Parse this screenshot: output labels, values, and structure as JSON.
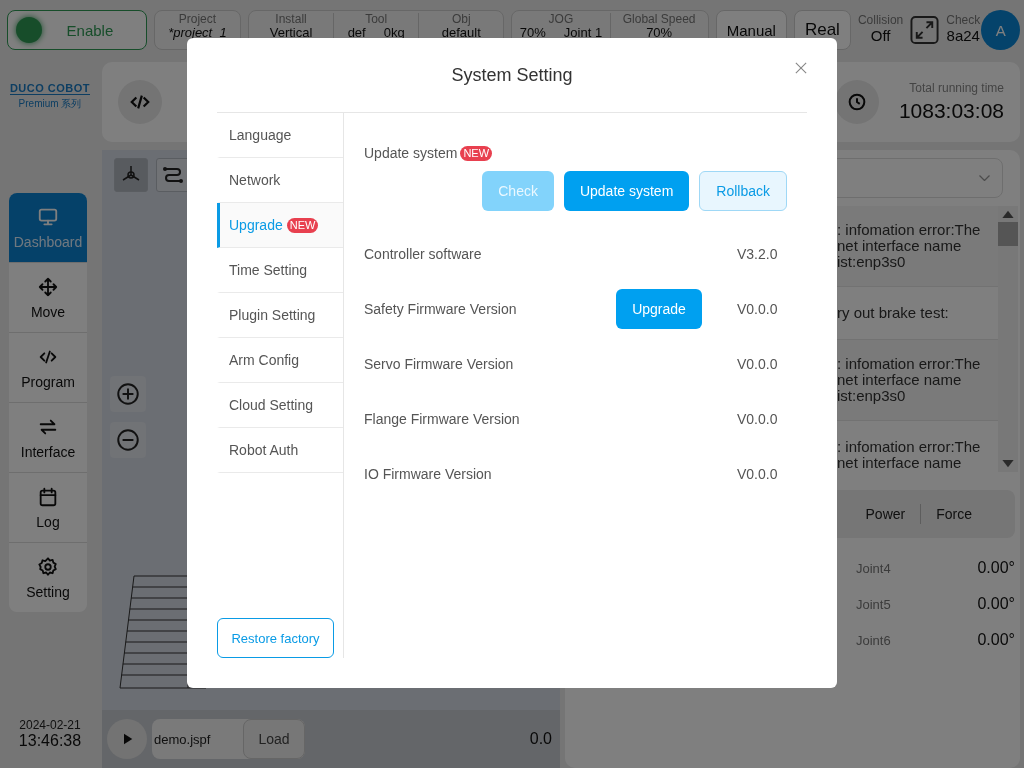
{
  "status_bar": {
    "enable": {
      "label": "Enable",
      "on": true
    },
    "project": {
      "label": "Project",
      "value": "*project_1"
    },
    "group_1": [
      {
        "label": "Install",
        "values": [
          "Vertical"
        ]
      },
      {
        "label": "Tool",
        "values": [
          "def",
          "0kg"
        ]
      },
      {
        "label": "Obj",
        "values": [
          "default"
        ]
      }
    ],
    "group_2": [
      {
        "label": "JOG",
        "values": [
          "70%",
          "Joint 1"
        ]
      },
      {
        "label": "Global Speed",
        "values": [
          "70%"
        ]
      }
    ],
    "mode_buttons": [
      "Manual",
      "Real"
    ],
    "collision": {
      "label": "Collision",
      "value": "Off"
    },
    "check": {
      "label": "Check",
      "value": "8a24"
    },
    "avatar": "A"
  },
  "logo": {
    "brand": "DUCO COBOT",
    "series": "Premium 系列"
  },
  "nav": [
    {
      "label": "Dashboard",
      "selected": true
    },
    {
      "label": "Move",
      "selected": false
    },
    {
      "label": "Program",
      "selected": false
    },
    {
      "label": "Interface",
      "selected": false
    },
    {
      "label": "Log",
      "selected": false
    },
    {
      "label": "Setting",
      "selected": false
    }
  ],
  "clock": {
    "date": "2024-02-21",
    "time": "13:46:38"
  },
  "running_time": {
    "label": "Total running time",
    "value": "1083:03:08"
  },
  "log": [
    {
      "lines": [
        ": infomation error:The",
        "net interface name",
        "ist:enp3s0"
      ]
    },
    {
      "lines": [
        "ry out brake test:"
      ]
    },
    {
      "lines": [
        ": infomation error:The",
        "net interface name",
        "ist:enp3s0"
      ]
    },
    {
      "lines": [
        ": infomation error:The",
        "net interface name"
      ]
    }
  ],
  "result_tabs": [
    "Power",
    "Force"
  ],
  "joints": [
    {
      "name": "Joint4",
      "value": "0.00°"
    },
    {
      "name": "Joint5",
      "value": "0.00°"
    },
    {
      "name": "Joint6",
      "value": "0.00°"
    }
  ],
  "program": {
    "file": "demo.jspf",
    "load": "Load",
    "value": "0.0"
  },
  "dialog": {
    "title": "System Setting",
    "menu": [
      {
        "label": "Language",
        "selected": false
      },
      {
        "label": "Network",
        "selected": false
      },
      {
        "label": "Upgrade",
        "badge": "NEW",
        "selected": true
      },
      {
        "label": "Time Setting",
        "selected": false
      },
      {
        "label": "Plugin Setting",
        "selected": false
      },
      {
        "label": "Arm Config",
        "selected": false
      },
      {
        "label": "Cloud Setting",
        "selected": false
      },
      {
        "label": "Robot Auth",
        "selected": false
      }
    ],
    "restore": "Restore factory",
    "update": {
      "label": "Update system",
      "badge": "NEW",
      "buttons": [
        {
          "label": "Check",
          "kind": "primary",
          "disabled": true
        },
        {
          "label": "Update system",
          "kind": "primary",
          "disabled": false
        },
        {
          "label": "Rollback",
          "kind": "plain",
          "disabled": false
        }
      ]
    },
    "rows": [
      {
        "label": "Controller software",
        "value": "V3.2.0"
      },
      {
        "label": "Safety Firmware Version",
        "action": "Upgrade",
        "value": "V0.0.0"
      },
      {
        "label": "Servo Firmware Version",
        "value": "V0.0.0"
      },
      {
        "label": "Flange Firmware Version",
        "value": "V0.0.0"
      },
      {
        "label": "IO Firmware Version",
        "value": "V0.0.0"
      }
    ]
  }
}
